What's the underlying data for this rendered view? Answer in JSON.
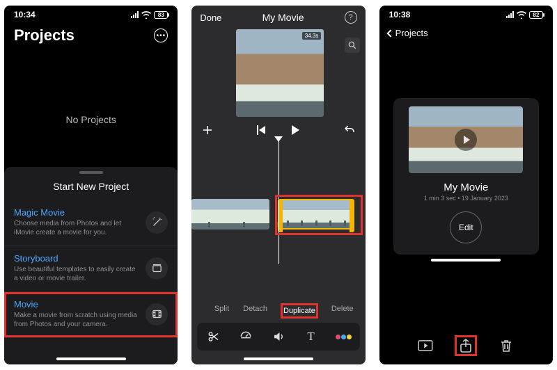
{
  "screen1": {
    "time": "10:34",
    "battery": "83",
    "title": "Projects",
    "no_projects": "No Projects",
    "sheet_title": "Start New Project",
    "options": [
      {
        "title": "Magic Movie",
        "desc": "Choose media from Photos and let iMovie create a movie for you."
      },
      {
        "title": "Storyboard",
        "desc": "Use beautiful templates to easily create a video or movie trailer."
      },
      {
        "title": "Movie",
        "desc": "Make a movie from scratch using media from Photos and your camera."
      }
    ]
  },
  "screen2": {
    "done": "Done",
    "title": "My Movie",
    "duration_badge": "34.3s",
    "actions": {
      "split": "Split",
      "detach": "Detach",
      "duplicate": "Duplicate",
      "delete": "Delete"
    }
  },
  "screen3": {
    "time": "10:38",
    "battery": "82",
    "back_label": "Projects",
    "project_title": "My Movie",
    "project_meta": "1 min 3 sec • 19 January 2023",
    "edit": "Edit"
  }
}
